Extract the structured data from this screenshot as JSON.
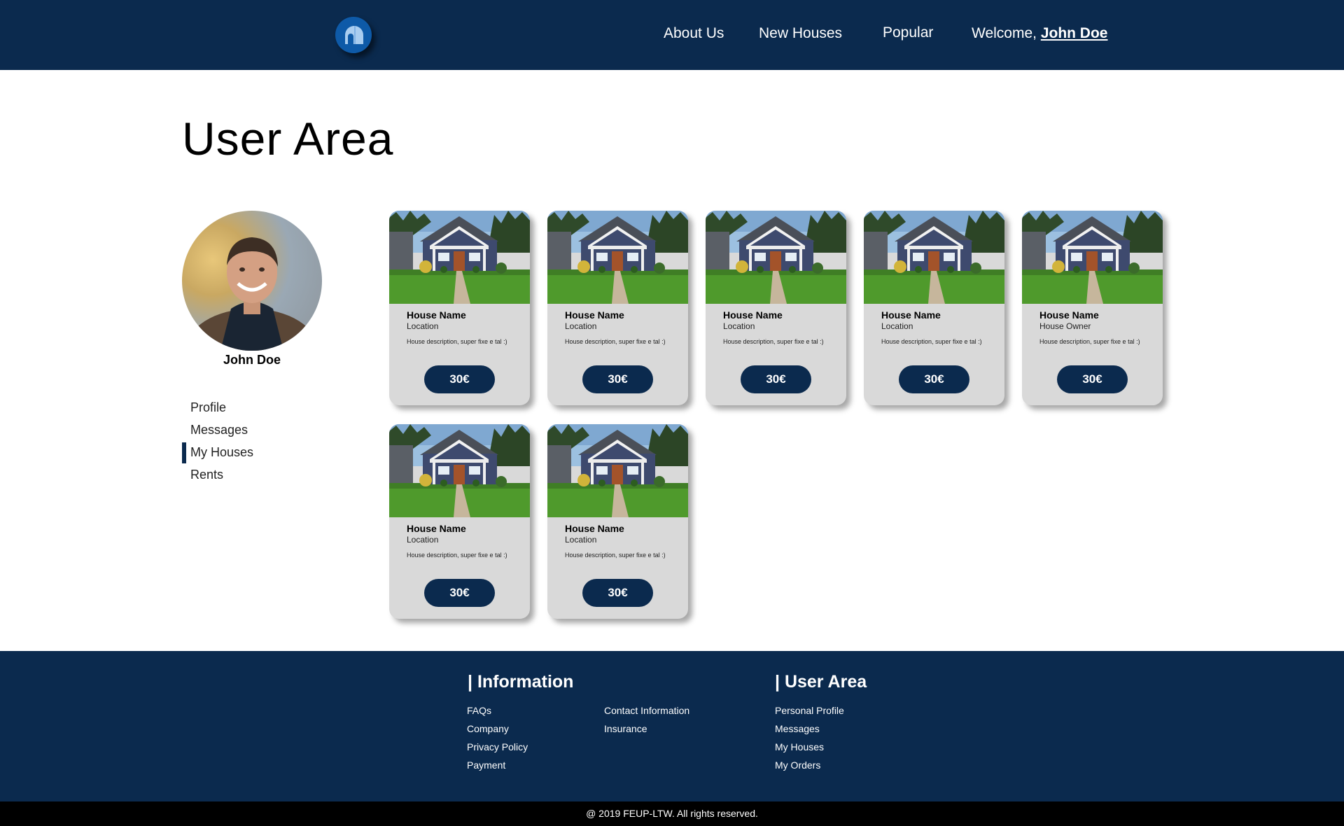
{
  "header": {
    "logo_icon": "igloo-logo-icon",
    "nav": {
      "about": "About Us",
      "new_houses": "New Houses",
      "popular": "Popular",
      "welcome_prefix": "Welcome, ",
      "welcome_user": "John Doe"
    }
  },
  "main": {
    "title": "User Area"
  },
  "sidebar": {
    "user_name": "John Doe",
    "items": [
      {
        "label": "Profile"
      },
      {
        "label": "Messages"
      },
      {
        "label": "My Houses"
      },
      {
        "label": "Rents"
      }
    ],
    "active_item": "My Houses"
  },
  "houses": [
    {
      "name": "House Name",
      "subtitle": "Location",
      "description": "House description, super fixe e tal :)",
      "price": "30€"
    },
    {
      "name": "House Name",
      "subtitle": "Location",
      "description": "House description, super fixe e tal :)",
      "price": "30€"
    },
    {
      "name": "House Name",
      "subtitle": "Location",
      "description": "House description, super fixe e tal :)",
      "price": "30€"
    },
    {
      "name": "House Name",
      "subtitle": "Location",
      "description": "House description, super fixe e tal :)",
      "price": "30€"
    },
    {
      "name": "House Name",
      "subtitle": "House Owner",
      "description": "House description, super fixe e tal :)",
      "price": "30€"
    },
    {
      "name": "House Name",
      "subtitle": "Location",
      "description": "House description, super fixe e tal :)",
      "price": "30€"
    },
    {
      "name": "House Name",
      "subtitle": "Location",
      "description": "House description, super fixe e tal :)",
      "price": "30€"
    }
  ],
  "footer": {
    "information": {
      "heading": "| Information",
      "col1": [
        "FAQs",
        "Company",
        "Privacy Policy",
        "Payment"
      ],
      "col2": [
        "Contact Information",
        "Insurance"
      ]
    },
    "user_area": {
      "heading": "| User Area",
      "links": [
        "Personal Profile",
        "Messages",
        "My Houses",
        "My Orders"
      ]
    },
    "copyright": "@ 2019 FEUP-LTW. All rights reserved."
  },
  "colors": {
    "brand_navy": "#0b2a4e",
    "card_bg": "#d9d9d9",
    "logo_blue": "#0e5aa8"
  }
}
